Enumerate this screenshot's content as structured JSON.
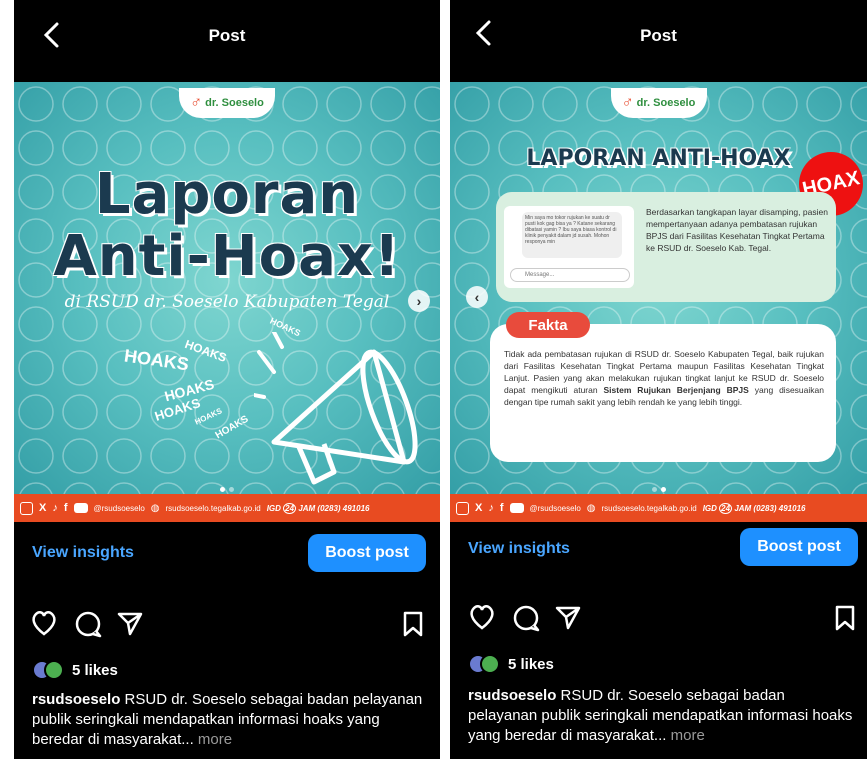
{
  "left": {
    "header": {
      "title": "Post"
    },
    "post": {
      "title_line1": "Laporan",
      "title_line2": "Anti-Hoax!",
      "subtitle": "di RSUD dr. Soeselo Kabupaten Tegal",
      "logo": "dr. Soeselo",
      "hoaks_words": [
        "HOAKS",
        "HOAKS",
        "HOAKS",
        "HOAKS",
        "HOAKS",
        "HOAKS",
        "HOAKS"
      ],
      "footer": {
        "handle": "@rsudsoeselo",
        "website": "rsudsoeselo.tegalkab.go.id",
        "igd_prefix": "IGD",
        "igd_hours": "24",
        "igd_suffix": "JAM (0283) 491016"
      }
    },
    "actions": {
      "insights": "View insights",
      "boost": "Boost post"
    },
    "likes": "5 likes",
    "caption": {
      "user": "rsudsoeselo",
      "text": "RSUD dr. Soeselo sebagai badan pelayanan publik seringkali mendapatkan informasi hoaks yang beredar di masyarakat...",
      "more": "more"
    }
  },
  "right": {
    "header": {
      "title": "Post"
    },
    "post": {
      "logo": "dr. Soeselo",
      "title": "LAPORAN ANTI-HOAX",
      "badge": "HOAX",
      "chat_text": "Min saya mo tokor rujukan ke suatu dr pusti kok gag bisa ya ? Katane sekarang dibatasi yamin ? Ibu saya biasa kontrol di klinik penyakit dalam jd susah. Mohon responya min",
      "chat_placeholder": "Message...",
      "screenshot_text": "Berdasarkan tangkapan layar disamping, pasien mempertanyaan adanya pembatasan rujukan BPJS dari Fasilitas Kesehatan Tingkat Pertama ke RSUD dr. Soeselo Kab. Tegal.",
      "fakta_label": "Fakta",
      "fakta_text_1": "Tidak ada pembatasan rujukan di RSUD dr. Soeselo Kabupaten Tegal, baik rujukan dari Fasilitas Kesehatan Tingkat Pertama maupun Fasilitas Kesehatan Tingkat Lanjut. Pasien yang akan melakukan rujukan tingkat lanjut ke RSUD dr. Soeselo dapat mengikuti aturan",
      "fakta_bold": "Sistem Rujukan Berjenjang BPJS",
      "fakta_text_2": "yang disesuaikan dengan tipe rumah sakit yang lebih rendah ke yang lebih tinggi.",
      "footer": {
        "handle": "@rsudsoeselo",
        "website": "rsudsoeselo.tegalkab.go.id",
        "igd_prefix": "IGD",
        "igd_hours": "24",
        "igd_suffix": "JAM (0283) 491016"
      }
    },
    "actions": {
      "insights": "View insights",
      "boost": "Boost post"
    },
    "likes": "5 likes",
    "caption": {
      "user": "rsudsoeselo",
      "text": "RSUD dr. Soeselo sebagai badan pelayanan publik seringkali mendapatkan informasi hoaks yang beredar di masyarakat...",
      "more": "more"
    }
  },
  "colors": {
    "accent": "#1e90ff",
    "link": "#4aa6ff",
    "brand_red": "#e84b21",
    "teal": "#58bfc0"
  },
  "icons": [
    "back-icon",
    "heart-icon",
    "comment-icon",
    "share-icon",
    "bookmark-icon",
    "chevron-right-icon",
    "chevron-left-icon",
    "instagram-icon",
    "x-icon",
    "tiktok-icon",
    "facebook-icon",
    "youtube-icon",
    "globe-icon",
    "megaphone-icon"
  ]
}
